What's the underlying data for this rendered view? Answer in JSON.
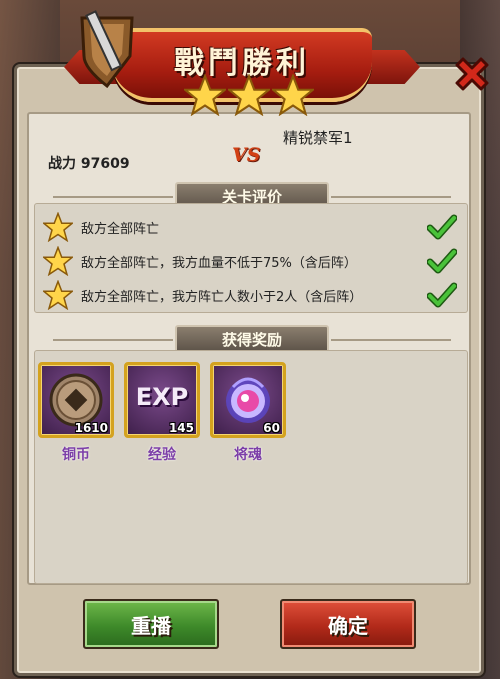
{
  "banner": {
    "title": "戰鬥勝利",
    "stars": 3
  },
  "header": {
    "power_label": "战力 97609",
    "vs": "VS",
    "enemy": "精锐禁军1"
  },
  "evaluation": {
    "title": "关卡评价",
    "items": [
      {
        "text": "敌方全部阵亡",
        "achieved": true
      },
      {
        "text": "敌方全部阵亡，我方血量不低于75%（含后阵）",
        "achieved": true
      },
      {
        "text": "敌方全部阵亡，我方阵亡人数小于2人（含后阵）",
        "achieved": true
      }
    ]
  },
  "rewards": {
    "title": "获得奖励",
    "items": [
      {
        "name": "铜币",
        "qty": "1610",
        "icon": "copper-coin-icon"
      },
      {
        "name": "经验",
        "qty": "145",
        "icon": "exp-icon",
        "icon_text": "EXP"
      },
      {
        "name": "将魂",
        "qty": "60",
        "icon": "general-soul-icon"
      }
    ]
  },
  "buttons": {
    "replay": "重播",
    "confirm": "确定"
  },
  "colors": {
    "gold": "#f2c26a",
    "banner_red": "#c2321e",
    "reward_name": "#7c3ea8",
    "check_green": "#3aa82a"
  }
}
